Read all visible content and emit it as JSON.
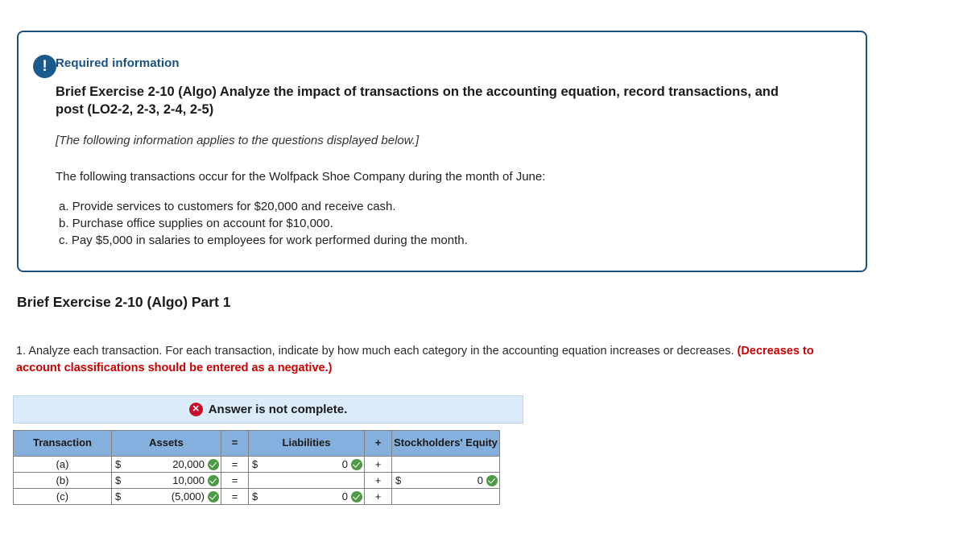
{
  "card": {
    "alert_icon": "exclamation-icon",
    "required_label": "Required information",
    "title": "Brief Exercise 2-10 (Algo) Analyze the impact of transactions on the accounting equation, record transactions, and post (LO2-2, 2-3, 2-4, 2-5)",
    "italic_note": "[The following information applies to the questions displayed below.]",
    "intro": "The following transactions occur for the Wolfpack Shoe Company during the month of June:",
    "transactions": [
      "a. Provide services to customers for $20,000 and receive cash.",
      "b. Purchase office supplies on account for $10,000.",
      "c. Pay $5,000 in salaries to employees for work performed during the month."
    ]
  },
  "part": {
    "heading": "Brief Exercise 2-10 (Algo) Part 1",
    "instruction_main": "1. Analyze each transaction. For each transaction, indicate by how much each category in the accounting equation increases or decreases. ",
    "instruction_warning": "(Decreases to account classifications should be entered as a negative.)"
  },
  "answer": {
    "banner_icon": "error-x-icon",
    "banner_text": "Answer is not complete.",
    "colors": {
      "header_blue": "#85b0dd",
      "banner_blue": "#dcebf9",
      "warning_red": "#cc0000",
      "check_green": "#4c9a45",
      "error_red": "#c8102e",
      "card_border_blue": "#1b4f7e"
    },
    "columns": [
      "Transaction",
      "Assets",
      "=",
      "Liabilities",
      "+",
      "Stockholders' Equity"
    ],
    "rows": [
      {
        "transaction": "(a)",
        "assets": {
          "currency": "$",
          "value": "20,000",
          "checked": true
        },
        "equals": "=",
        "liabilities": {
          "currency": "$",
          "value": "0",
          "checked": true
        },
        "plus": "+",
        "equity": {
          "currency": "",
          "value": "",
          "checked": false,
          "blank": true
        }
      },
      {
        "transaction": "(b)",
        "assets": {
          "currency": "$",
          "value": "10,000",
          "checked": true
        },
        "equals": "=",
        "liabilities": {
          "currency": "",
          "value": "",
          "checked": false,
          "blank": true
        },
        "plus": "+",
        "equity": {
          "currency": "$",
          "value": "0",
          "checked": true
        }
      },
      {
        "transaction": "(c)",
        "assets": {
          "currency": "$",
          "value": "(5,000)",
          "checked": true
        },
        "equals": "=",
        "liabilities": {
          "currency": "$",
          "value": "0",
          "checked": true
        },
        "plus": "+",
        "equity": {
          "currency": "",
          "value": "",
          "checked": false,
          "blank": true
        }
      }
    ]
  }
}
